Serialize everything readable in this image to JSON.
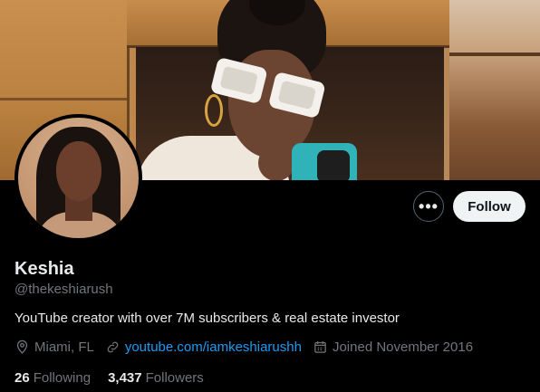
{
  "profile": {
    "name": "Keshia",
    "handle": "@thekeshiarush",
    "bio": "YouTube creator with over 7M subscribers & real estate investor",
    "location": "Miami, FL",
    "website": "youtube.com/iamkeshiarushh",
    "joined": "Joined November 2016"
  },
  "actions": {
    "more_label": "•••",
    "follow_label": "Follow"
  },
  "stats": {
    "following_count": "26",
    "following_label": "Following",
    "followers_count": "3,437",
    "followers_label": "Followers"
  },
  "icons": {
    "location": "location-pin-icon",
    "website": "link-icon",
    "joined": "calendar-icon"
  },
  "colors": {
    "background": "#000000",
    "text_primary": "#e7e9ea",
    "text_secondary": "#71767b",
    "link": "#1d9bf0",
    "follow_bg": "#eff3f4"
  }
}
